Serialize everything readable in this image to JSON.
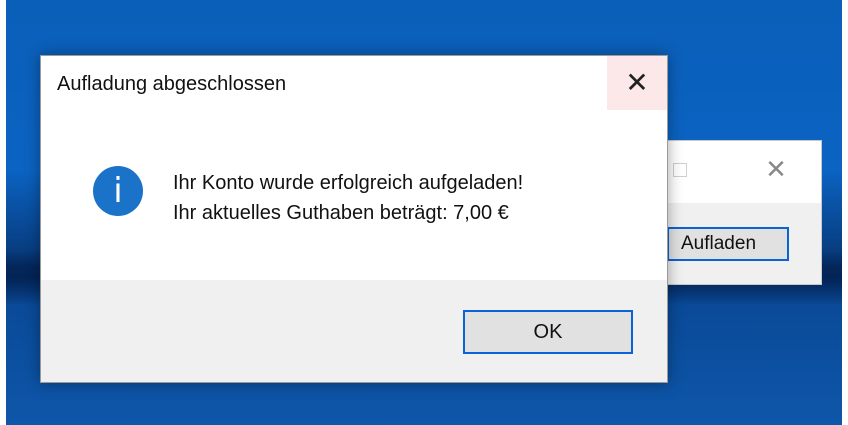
{
  "background_window": {
    "button_label": "Aufladen",
    "close_glyph": "✕"
  },
  "dialog": {
    "title": "Aufladung abgeschlossen",
    "close_glyph": "✕",
    "icon": "info-icon",
    "icon_glyph": "i",
    "message_line1": "Ihr Konto wurde erfolgreich aufgeladen!",
    "message_line2": "Ihr aktuelles Guthaben beträgt: 7,00 €",
    "ok_label": "OK"
  },
  "colors": {
    "accent": "#0a63d6",
    "info_icon": "#1a73c9",
    "close_hover": "#fce8e8"
  }
}
